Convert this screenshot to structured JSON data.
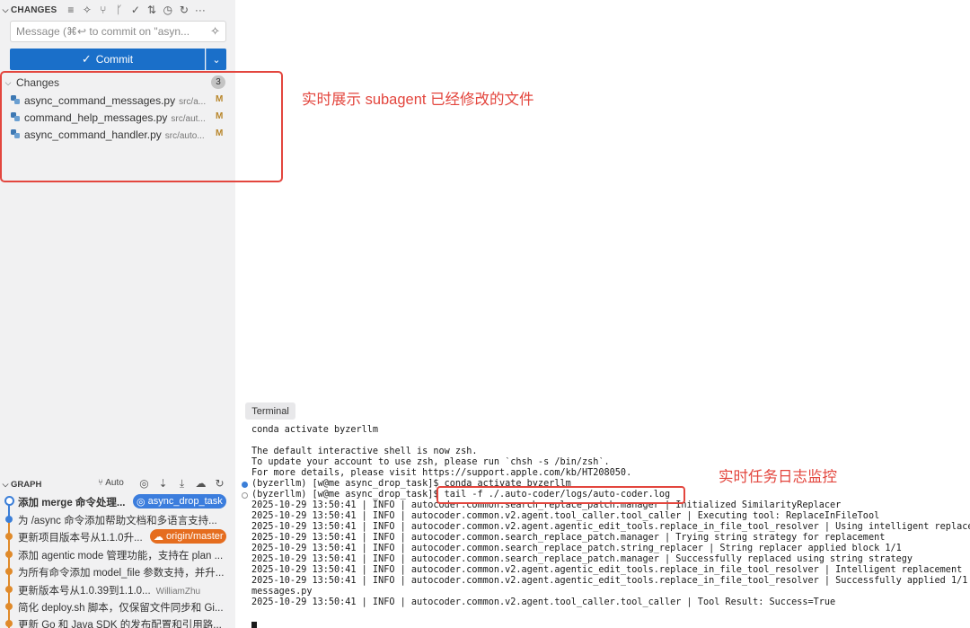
{
  "scm": {
    "header_title": "CHANGES",
    "message_placeholder": "Message (⌘↩ to commit on \"asyn...",
    "commit_label": "Commit",
    "changes_group_label": "Changes",
    "changes_count": "3",
    "files": [
      {
        "name": "async_command_messages.py",
        "path": "src/a...",
        "status": "M"
      },
      {
        "name": "command_help_messages.py",
        "path": "src/aut...",
        "status": "M"
      },
      {
        "name": "async_command_handler.py",
        "path": "src/auto...",
        "status": "M"
      }
    ]
  },
  "graph": {
    "header_title": "GRAPH",
    "auto_label": "Auto",
    "commits": [
      {
        "text": "添加 merge 命令处理...",
        "tag": "async_drop_task",
        "tag_color": "#3b7ddd"
      },
      {
        "text": "为 /async 命令添加帮助文档和多语言支持..."
      },
      {
        "text": "更新项目版本号从1.1.0升...",
        "tag": "origin/master",
        "tag_color": "#e56d1f"
      },
      {
        "text": "添加 agentic mode 管理功能，支持在 plan ..."
      },
      {
        "text": "为所有命令添加 model_file 参数支持，并升..."
      },
      {
        "text": "更新版本号从1.0.39到1.1.0...",
        "author": "WilliamZhu"
      },
      {
        "text": "简化 deploy.sh 脚本，仅保留文件同步和 Gi..."
      },
      {
        "text": "更新 Go 和 Java SDK 的发布配置和引用路..."
      }
    ]
  },
  "terminal": {
    "tab_label": "Terminal",
    "lines": [
      "conda activate byzerllm",
      "",
      "The default interactive shell is now zsh.",
      "To update your account to use zsh, please run `chsh -s /bin/zsh`.",
      "For more details, please visit https://support.apple.com/kb/HT208050.",
      "(byzerllm) [w@me async_drop_task]$ conda activate byzerllm",
      "(byzerllm) [w@me async_drop_task]$ tail -f ./.auto-coder/logs/auto-coder.log",
      "2025-10-29 13:50:41 | INFO | autocoder.common.search_replace_patch.manager | Initialized SimilarityReplacer",
      "2025-10-29 13:50:41 | INFO | autocoder.common.v2.agent.tool_caller.tool_caller | Executing tool: ReplaceInFileTool",
      "2025-10-29 13:50:41 | INFO | autocoder.common.v2.agent.agentic_edit_tools.replace_in_file_tool_resolver | Using intelligent replacement",
      "2025-10-29 13:50:41 | INFO | autocoder.common.search_replace_patch.manager | Trying string strategy for replacement",
      "2025-10-29 13:50:41 | INFO | autocoder.common.search_replace_patch.string_replacer | String replacer applied block 1/1",
      "2025-10-29 13:50:41 | INFO | autocoder.common.search_replace_patch.manager | Successfully replaced using string strategy",
      "2025-10-29 13:50:41 | INFO | autocoder.common.v2.agent.agentic_edit_tools.replace_in_file_tool_resolver | Intelligent replacement",
      "2025-10-29 13:50:41 | INFO | autocoder.common.v2.agent.agentic_edit_tools.replace_in_file_tool_resolver | Successfully applied 1/1",
      "messages.py",
      "2025-10-29 13:50:41 | INFO | autocoder.common.v2.agent.tool_caller.tool_caller | Tool Result: Success=True"
    ]
  },
  "annotations": {
    "files_note": "实时展示 subagent 已经修改的文件",
    "log_note": "实时任务日志监控",
    "color": "#e3463e"
  }
}
